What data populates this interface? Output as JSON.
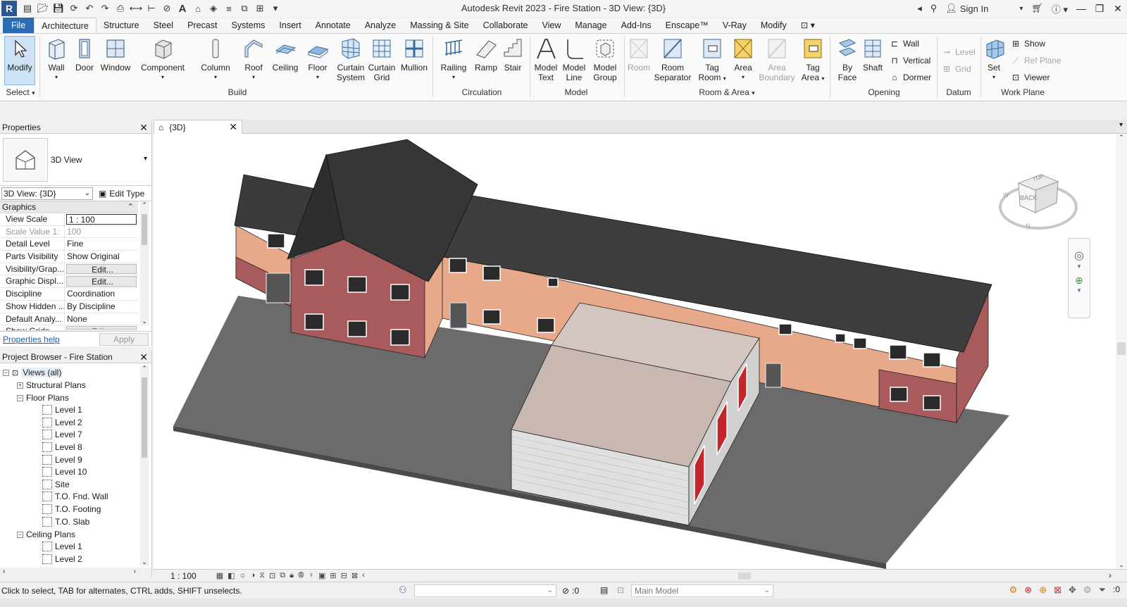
{
  "window": {
    "title": "Autodesk Revit 2023 - Fire Station - 3D View: {3D}",
    "sign_in": "Sign In",
    "app_letter": "R"
  },
  "tabs": [
    "File",
    "Architecture",
    "Structure",
    "Steel",
    "Precast",
    "Systems",
    "Insert",
    "Annotate",
    "Analyze",
    "Massing & Site",
    "Collaborate",
    "View",
    "Manage",
    "Add-Ins",
    "Enscape™",
    "V-Ray",
    "Modify"
  ],
  "active_tab": "Architecture",
  "ribbon": {
    "select": {
      "modify": "Modify",
      "group": "Select"
    },
    "build": {
      "group": "Build",
      "wall": "Wall",
      "door": "Door",
      "window": "Window",
      "component": "Component",
      "column": "Column",
      "roof": "Roof",
      "ceiling": "Ceiling",
      "floor": "Floor",
      "curtain_system_1": "Curtain",
      "curtain_system_2": "System",
      "curtain_grid_1": "Curtain",
      "curtain_grid_2": "Grid",
      "mullion": "Mullion"
    },
    "circulation": {
      "group": "Circulation",
      "railing": "Railing",
      "ramp": "Ramp",
      "stair": "Stair"
    },
    "model": {
      "group": "Model",
      "model_text_1": "Model",
      "model_text_2": "Text",
      "model_line_1": "Model",
      "model_line_2": "Line",
      "model_group_1": "Model",
      "model_group_2": "Group"
    },
    "room_area": {
      "group": "Room & Area",
      "room": "Room",
      "room_sep_1": "Room",
      "room_sep_2": "Separator",
      "tag_room_1": "Tag",
      "tag_room_2": "Room",
      "area": "Area",
      "area_boundary_1": "Area",
      "area_boundary_2": "Boundary",
      "tag_area_1": "Tag",
      "tag_area_2": "Area"
    },
    "opening": {
      "group": "Opening",
      "by_face_1": "By",
      "by_face_2": "Face",
      "shaft": "Shaft",
      "wall": "Wall",
      "vertical": "Vertical",
      "dormer": "Dormer"
    },
    "datum": {
      "group": "Datum",
      "level": "Level",
      "grid": "Grid"
    },
    "work_plane": {
      "group": "Work Plane",
      "set": "Set",
      "show": "Show",
      "ref_plane": "Ref  Plane",
      "viewer": "Viewer"
    }
  },
  "properties": {
    "header": "Properties",
    "type_name": "3D View",
    "view_selector": "3D View: {3D}",
    "edit_type": "Edit Type",
    "section": "Graphics",
    "rows": [
      {
        "name": "View Scale",
        "value": "1 : 100"
      },
      {
        "name": "Scale Value    1:",
        "value": "100"
      },
      {
        "name": "Detail Level",
        "value": "Fine"
      },
      {
        "name": "Parts Visibility",
        "value": "Show Original"
      },
      {
        "name": "Visibility/Grap...",
        "value": "Edit..."
      },
      {
        "name": "Graphic Displ...",
        "value": "Edit..."
      },
      {
        "name": "Discipline",
        "value": "Coordination"
      },
      {
        "name": "Show Hidden ...",
        "value": "By Discipline"
      },
      {
        "name": "Default Analy...",
        "value": "None"
      },
      {
        "name": "Show Grids",
        "value": "Edit..."
      }
    ],
    "help_link": "Properties help",
    "apply": "Apply"
  },
  "browser": {
    "header": "Project Browser - Fire Station",
    "root": "Views (all)",
    "structural_plans": "Structural Plans",
    "floor_plans": "Floor Plans",
    "floor_plan_items": [
      "Level 1",
      "Level 2",
      "Level 7",
      "Level 8",
      "Level 9",
      "Level 10",
      "Site",
      "T.O. Fnd. Wall",
      "T.O. Footing",
      "T.O. Slab"
    ],
    "ceiling_plans": "Ceiling Plans",
    "ceiling_plan_items": [
      "Level 1",
      "Level 2"
    ]
  },
  "view": {
    "tab_label": "{3D}",
    "scale": "1 : 100",
    "viewcube": {
      "top": "TOP",
      "back": "BACK",
      "w": "W",
      "n": "N"
    }
  },
  "status": {
    "message": "Click to select, TAB for alternates, CTRL adds, SHIFT unselects.",
    "count": ":0",
    "model": "Main Model",
    "filter_count": ":0"
  },
  "colors": {
    "accent": "#2b6cb3",
    "roof": "#3b3b3b",
    "wall_peach": "#e8a88a",
    "wall_red": "#a85a5c",
    "site": "#6b6b6b",
    "bay_roof": "#c9b7b2",
    "door_red": "#c0262a"
  }
}
